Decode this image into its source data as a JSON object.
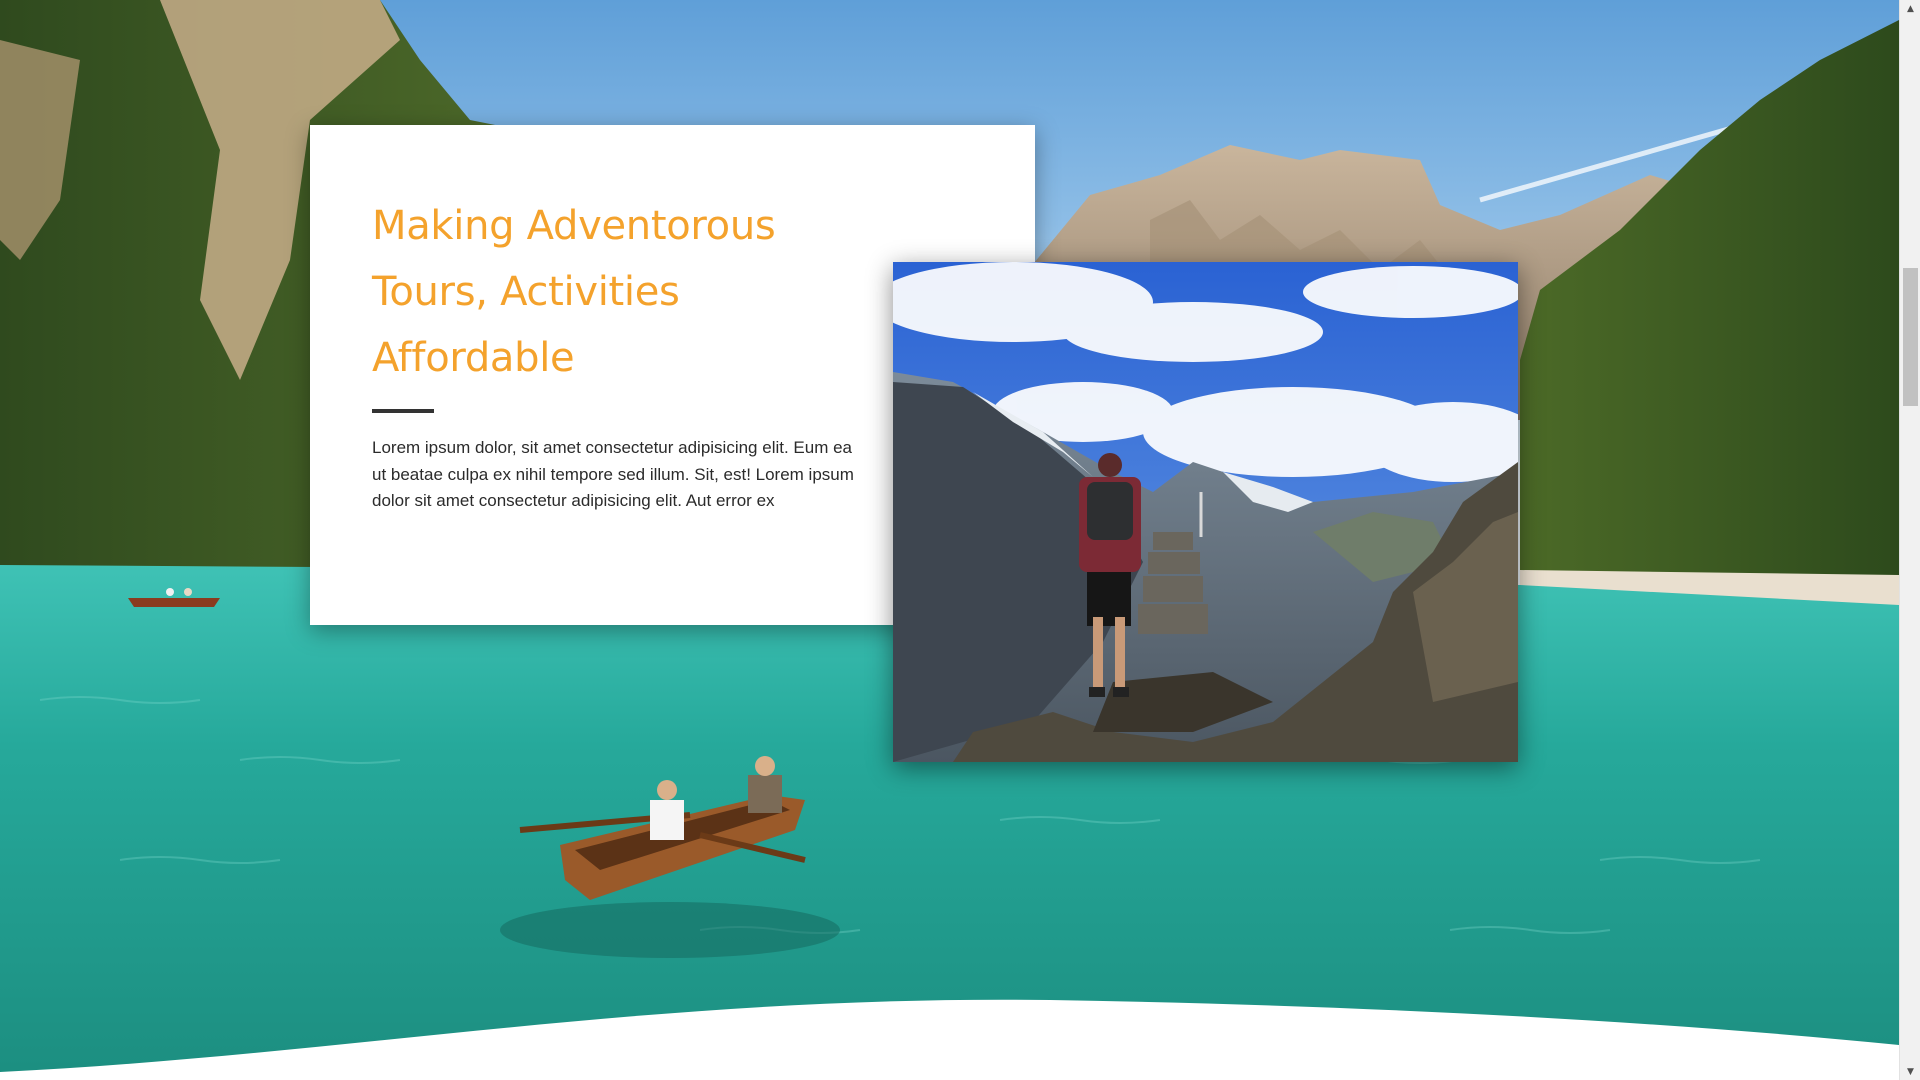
{
  "hero": {
    "headline_lines": [
      "Making Adventorous",
      "Tours, Activities",
      "Affordable"
    ],
    "body": "Lorem ipsum dolor, sit amet consectetur adipisicing elit. Eum ea ut beatae culpa ex nihil tempore sed illum. Sit, est! Lorem ipsum dolor sit amet consectetur adipisicing elit. Aut error ex"
  },
  "colors": {
    "accent": "#f4a22c",
    "divider": "#333333",
    "water": "#2fb3a6",
    "body_text": "#2b2b2b"
  },
  "icons": {
    "scroll_up": "triangle-up",
    "scroll_down": "triangle-down"
  }
}
